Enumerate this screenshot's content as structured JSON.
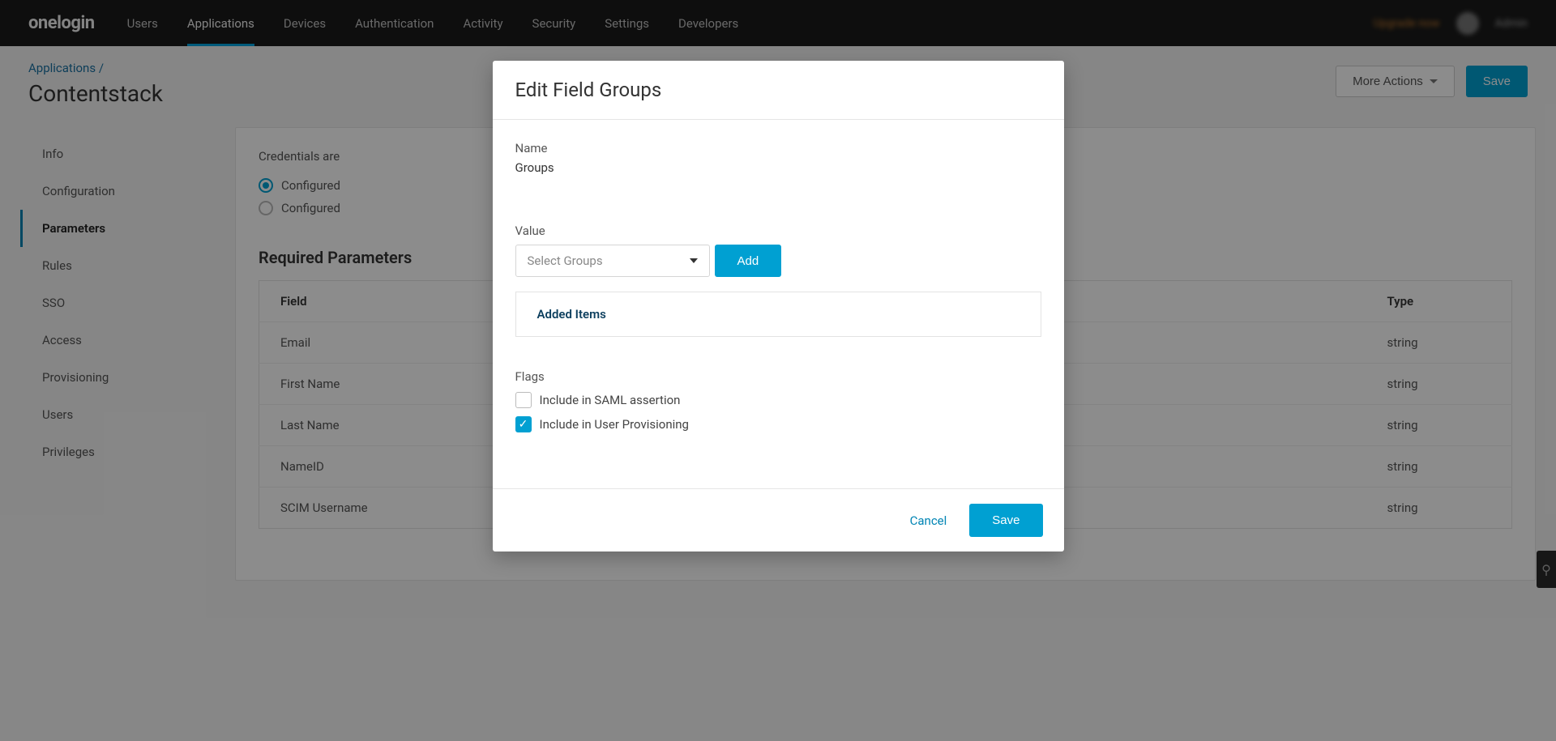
{
  "brand": "onelogin",
  "nav": [
    {
      "label": "Users"
    },
    {
      "label": "Applications",
      "active": true
    },
    {
      "label": "Devices"
    },
    {
      "label": "Authentication"
    },
    {
      "label": "Activity"
    },
    {
      "label": "Security"
    },
    {
      "label": "Settings"
    },
    {
      "label": "Developers"
    }
  ],
  "topbar_right": {
    "upgrade": "Upgrade now",
    "username": "Admin"
  },
  "breadcrumb": {
    "parent": "Applications",
    "sep": "/"
  },
  "page_title": "Contentstack",
  "header_actions": {
    "more": "More Actions",
    "save": "Save"
  },
  "sidebar": [
    {
      "label": "Info"
    },
    {
      "label": "Configuration"
    },
    {
      "label": "Parameters",
      "active": true
    },
    {
      "label": "Rules"
    },
    {
      "label": "SSO"
    },
    {
      "label": "Access"
    },
    {
      "label": "Provisioning"
    },
    {
      "label": "Users"
    },
    {
      "label": "Privileges"
    }
  ],
  "main": {
    "credentials_label": "Credentials are",
    "radio1": "Configured",
    "radio2": "Configured",
    "required_title": "Required Parameters",
    "table_headers": {
      "field": "Field",
      "type": "Type"
    },
    "rows": [
      {
        "field": "Email",
        "type": "string"
      },
      {
        "field": "First Name",
        "type": "string"
      },
      {
        "field": "Last Name",
        "type": "string"
      },
      {
        "field": "NameID",
        "type": "string"
      },
      {
        "field": "SCIM Username",
        "type": "string"
      }
    ]
  },
  "modal": {
    "title": "Edit Field Groups",
    "name_label": "Name",
    "name_value": "Groups",
    "value_label": "Value",
    "select_placeholder": "Select Groups",
    "add_btn": "Add",
    "added_items": "Added Items",
    "flags_label": "Flags",
    "flag_saml": "Include in SAML assertion",
    "flag_prov": "Include in User Provisioning",
    "cancel": "Cancel",
    "save": "Save"
  }
}
